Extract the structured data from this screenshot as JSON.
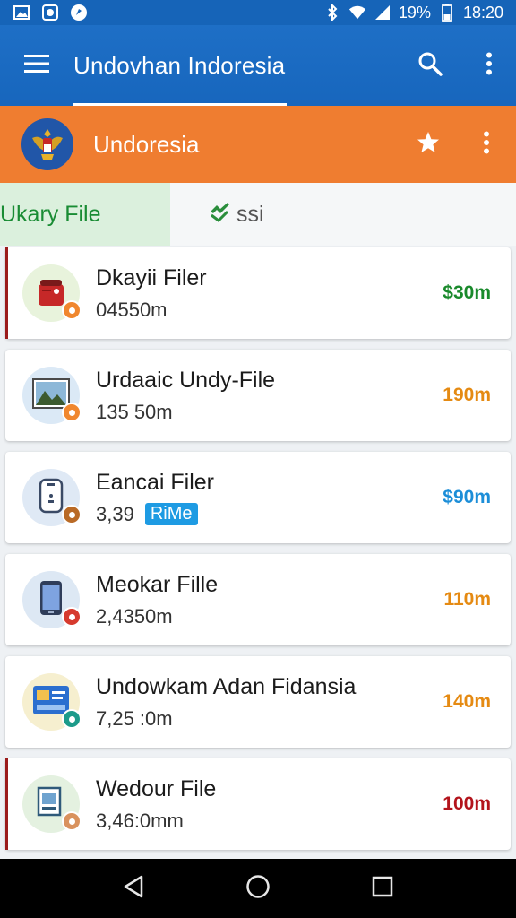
{
  "status_bar": {
    "battery": "19%",
    "time": "18:20"
  },
  "appbar": {
    "title": "Undovhan Indoresia"
  },
  "subbar": {
    "title": "Undoresia"
  },
  "tabs": [
    {
      "label": "Ukary File"
    },
    {
      "label": "ssi"
    }
  ],
  "files": [
    {
      "name": "Dkayii Filer",
      "size": "04550m",
      "pill": "",
      "amount": "$30m",
      "amount_color": "#1a8a2c",
      "avatar_bg": "#e8f3dc",
      "badge_color": "#f0872e",
      "edge_color": "#9b1c1c",
      "icon": "red-bag-icon"
    },
    {
      "name": "Urdaaic Undy-File",
      "size": "135 50m",
      "pill": "",
      "amount": "190m",
      "amount_color": "#e58a12",
      "avatar_bg": "#dbe9f6",
      "badge_color": "#f0872e",
      "edge_color": "",
      "icon": "landscape-image-icon"
    },
    {
      "name": "Eancai Filer",
      "size": "3,39",
      "pill": "RiMe",
      "amount": "$90m",
      "amount_color": "#1c8ed8",
      "avatar_bg": "#dfe9f5",
      "badge_color": "#b96a26",
      "edge_color": "",
      "icon": "device-icon"
    },
    {
      "name": "Meokar Fille",
      "size": "2,4350m",
      "pill": "",
      "amount": "110m",
      "amount_color": "#e58a12",
      "avatar_bg": "#dde8f4",
      "badge_color": "#d63a2e",
      "edge_color": "",
      "icon": "phone-icon"
    },
    {
      "name": "Undowkam Adan Fidansia",
      "size": "7,25 :0m",
      "pill": "",
      "amount": "140m",
      "amount_color": "#e58a12",
      "avatar_bg": "#f6efcf",
      "badge_color": "#1c9b8a",
      "edge_color": "",
      "icon": "id-card-icon"
    },
    {
      "name": "Wedour File",
      "size": "3,46:0mm",
      "pill": "",
      "amount": "100m",
      "amount_color": "#b3141c",
      "avatar_bg": "#e4f1e0",
      "badge_color": "#d9925e",
      "edge_color": "#9b1c1c",
      "icon": "document-person-icon"
    }
  ]
}
